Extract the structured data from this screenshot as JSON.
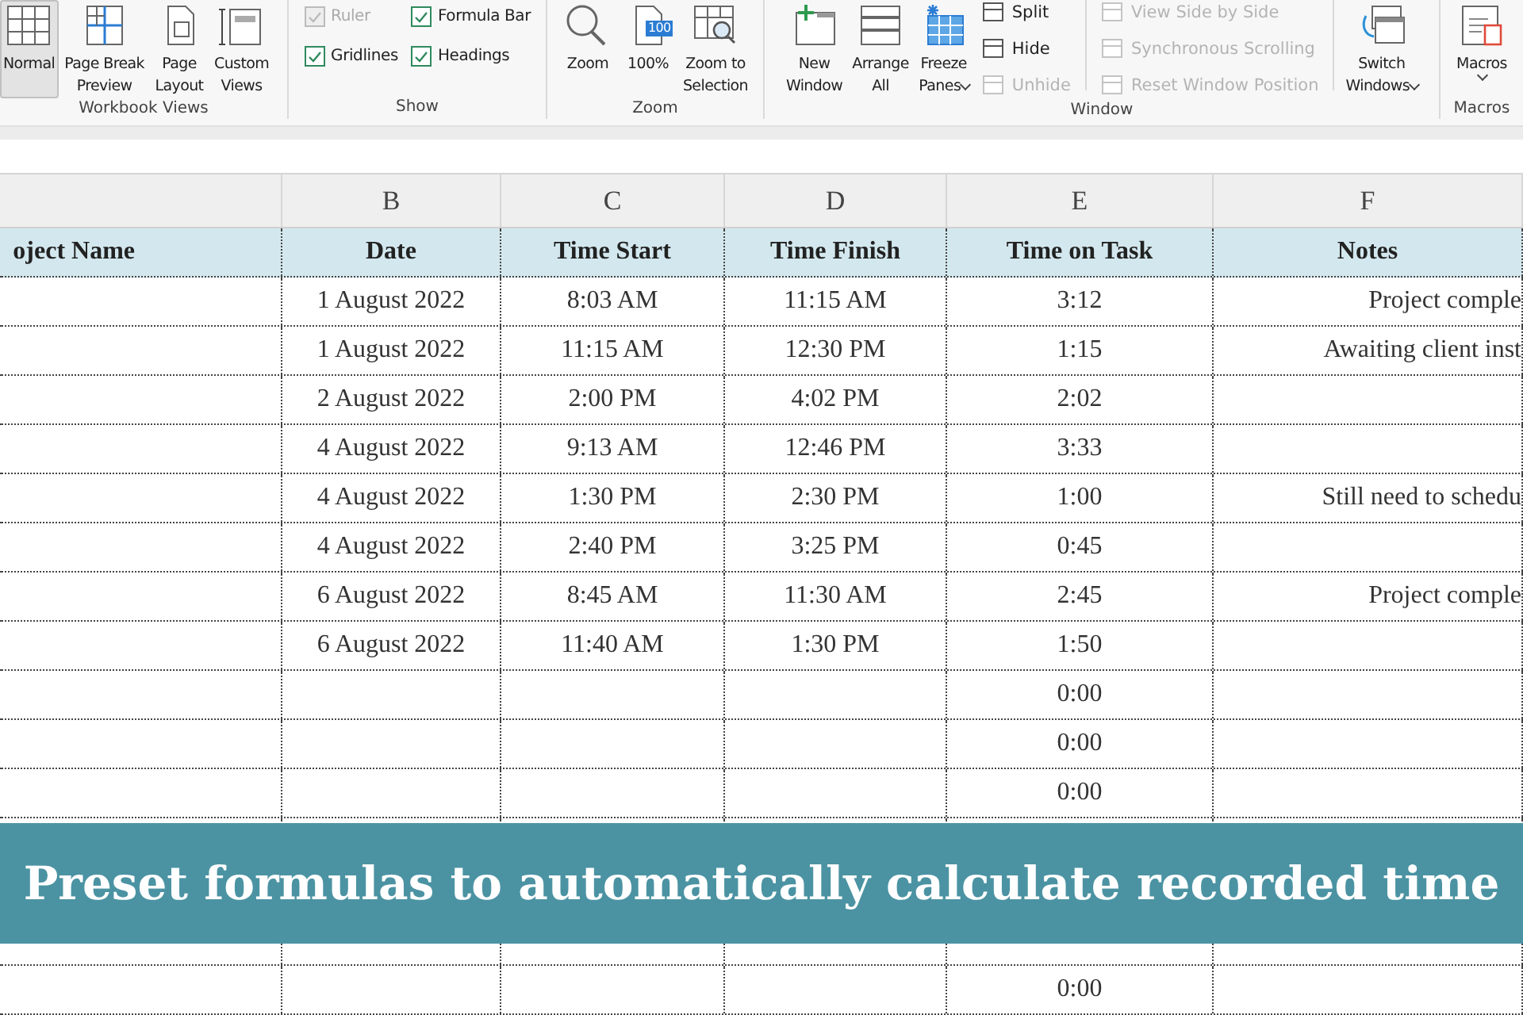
{
  "ribbon": {
    "groups": [
      {
        "label": "Workbook Views",
        "items": [
          {
            "kind": "large",
            "label_lines": [
              "Normal"
            ],
            "selected": true
          },
          {
            "kind": "large",
            "label_lines": [
              "Page Break",
              "Preview"
            ],
            "selected": false
          },
          {
            "kind": "large",
            "label_lines": [
              "Page",
              "Layout"
            ],
            "selected": false
          },
          {
            "kind": "large",
            "label_lines": [
              "Custom",
              "Views"
            ],
            "selected": false
          }
        ]
      },
      {
        "label": "Show",
        "items": [
          {
            "kind": "checks",
            "checks": [
              {
                "label": "Ruler",
                "checked": true,
                "disabled": true
              },
              {
                "label": "Formula Bar",
                "checked": true,
                "disabled": false
              },
              {
                "label": "Gridlines",
                "checked": true,
                "disabled": false
              },
              {
                "label": "Headings",
                "checked": true,
                "disabled": false
              }
            ]
          }
        ]
      },
      {
        "label": "Zoom",
        "items": [
          {
            "kind": "large",
            "label_lines": [
              "Zoom"
            ]
          },
          {
            "kind": "large",
            "label_lines": [
              "100%"
            ],
            "badge": "100"
          },
          {
            "kind": "large",
            "label_lines": [
              "Zoom to",
              "Selection"
            ]
          }
        ]
      },
      {
        "label": "Window",
        "items": [
          {
            "kind": "large",
            "label_lines": [
              "New",
              "Window"
            ]
          },
          {
            "kind": "large",
            "label_lines": [
              "Arrange",
              "All"
            ]
          },
          {
            "kind": "large",
            "label_lines": [
              "Freeze",
              "Panes"
            ],
            "dropdown": true
          },
          {
            "kind": "small",
            "entries": [
              {
                "label": "Split",
                "disabled": false
              },
              {
                "label": "Hide",
                "disabled": false
              },
              {
                "label": "Unhide",
                "disabled": true
              }
            ]
          },
          {
            "kind": "separator"
          },
          {
            "kind": "small",
            "entries": [
              {
                "label": "View Side by Side",
                "disabled": true
              },
              {
                "label": "Synchronous Scrolling",
                "disabled": true
              },
              {
                "label": "Reset Window Position",
                "disabled": true
              }
            ]
          },
          {
            "kind": "separator"
          },
          {
            "kind": "large",
            "label_lines": [
              "Switch",
              "Windows"
            ],
            "dropdown": true
          }
        ]
      },
      {
        "label": "Macros",
        "items": [
          {
            "kind": "large",
            "label_lines": [
              "Macros"
            ],
            "dropdown": true
          }
        ]
      }
    ]
  },
  "sheet": {
    "column_letters": [
      "B",
      "C",
      "D",
      "E",
      "F"
    ],
    "columns": [
      "oject Name",
      "Date",
      "Time Start",
      "Time Finish",
      "Time on Task",
      "Notes"
    ],
    "rows": [
      {
        "date": "1 August 2022",
        "start": "8:03 AM",
        "finish": "11:15 AM",
        "task": "3:12",
        "notes": "Project comple"
      },
      {
        "date": "1 August 2022",
        "start": "11:15 AM",
        "finish": "12:30 PM",
        "task": "1:15",
        "notes": "Awaiting client inst"
      },
      {
        "date": "2 August 2022",
        "start": "2:00 PM",
        "finish": "4:02 PM",
        "task": "2:02"
      },
      {
        "date": "4 August 2022",
        "start": "9:13 AM",
        "finish": "12:46 PM",
        "task": "3:33"
      },
      {
        "date": "4 August 2022",
        "start": "1:30 PM",
        "finish": "2:30 PM",
        "task": "1:00",
        "notes": "Still need to schedu"
      },
      {
        "date": "4 August 2022",
        "start": "2:40 PM",
        "finish": "3:25 PM",
        "task": "0:45"
      },
      {
        "date": "6 August 2022",
        "start": "8:45 AM",
        "finish": "11:30 AM",
        "task": "2:45",
        "notes": "Project comple"
      },
      {
        "date": "6 August 2022",
        "start": "11:40 AM",
        "finish": "1:30 PM",
        "task": "1:50"
      },
      {
        "task": "0:00"
      },
      {
        "task": "0:00"
      },
      {
        "task": "0:00"
      },
      {},
      {},
      {},
      {
        "task": "0:00"
      }
    ]
  },
  "banner": {
    "text": "Preset formulas to automatically calculate recorded time"
  }
}
